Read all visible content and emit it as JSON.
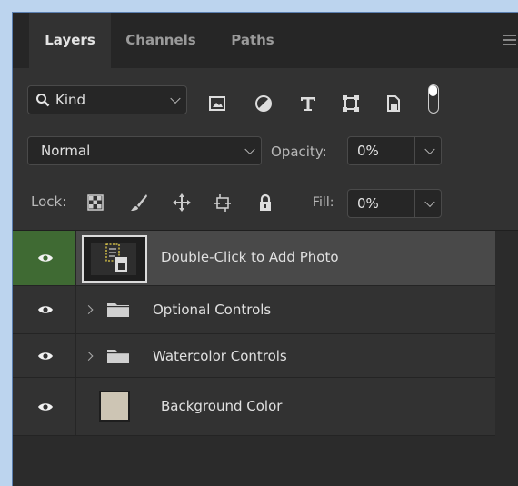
{
  "tabs": [
    {
      "label": "Layers",
      "active": true
    },
    {
      "label": "Channels",
      "active": false
    },
    {
      "label": "Paths",
      "active": false
    }
  ],
  "filter": {
    "kind_label": "Kind",
    "icons": [
      "pixel-layer-filter-icon",
      "adjustment-layer-filter-icon",
      "type-layer-filter-icon",
      "shape-layer-filter-icon",
      "smart-object-filter-icon"
    ],
    "toggle_state": "on"
  },
  "blend": {
    "mode": "Normal",
    "opacity_label": "Opacity:",
    "opacity_value": "0%"
  },
  "lock": {
    "label": "Lock:",
    "icons": [
      "lock-transparent-pixels-icon",
      "lock-image-pixels-icon",
      "lock-position-icon",
      "prevent-autonest-icon",
      "lock-all-icon"
    ],
    "fill_label": "Fill:",
    "fill_value": "0%"
  },
  "layers": [
    {
      "name": "Double-Click to Add Photo",
      "visible": true,
      "selected": true,
      "type": "smart-object"
    },
    {
      "name": "Optional Controls",
      "visible": true,
      "selected": false,
      "type": "group"
    },
    {
      "name": "Watercolor Controls",
      "visible": true,
      "selected": false,
      "type": "group"
    },
    {
      "name": "Background Color",
      "visible": true,
      "selected": false,
      "type": "fill",
      "swatch_color": "#cdc5b4"
    }
  ],
  "colors": {
    "panel_bg": "#323232",
    "visibility_active": "#3f6a33",
    "frame": "#bcd4ee"
  }
}
